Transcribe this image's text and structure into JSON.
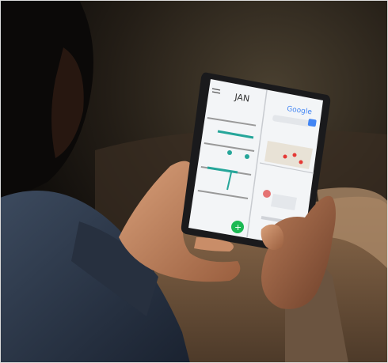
{
  "calendar": {
    "month": "JAN",
    "fab_symbol": "+"
  },
  "browser": {
    "logo": "Google"
  }
}
